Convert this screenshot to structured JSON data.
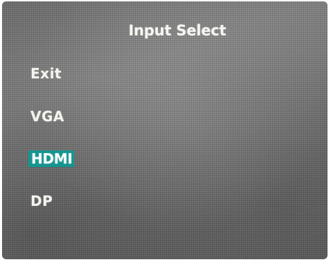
{
  "osd": {
    "title": "Input Select",
    "items": [
      {
        "label": "Exit",
        "selected": false
      },
      {
        "label": "VGA",
        "selected": false
      },
      {
        "label": "HDMI",
        "selected": true
      },
      {
        "label": "DP",
        "selected": false
      }
    ],
    "highlight_color": "#15958f",
    "text_color": "#f4f4ef"
  }
}
